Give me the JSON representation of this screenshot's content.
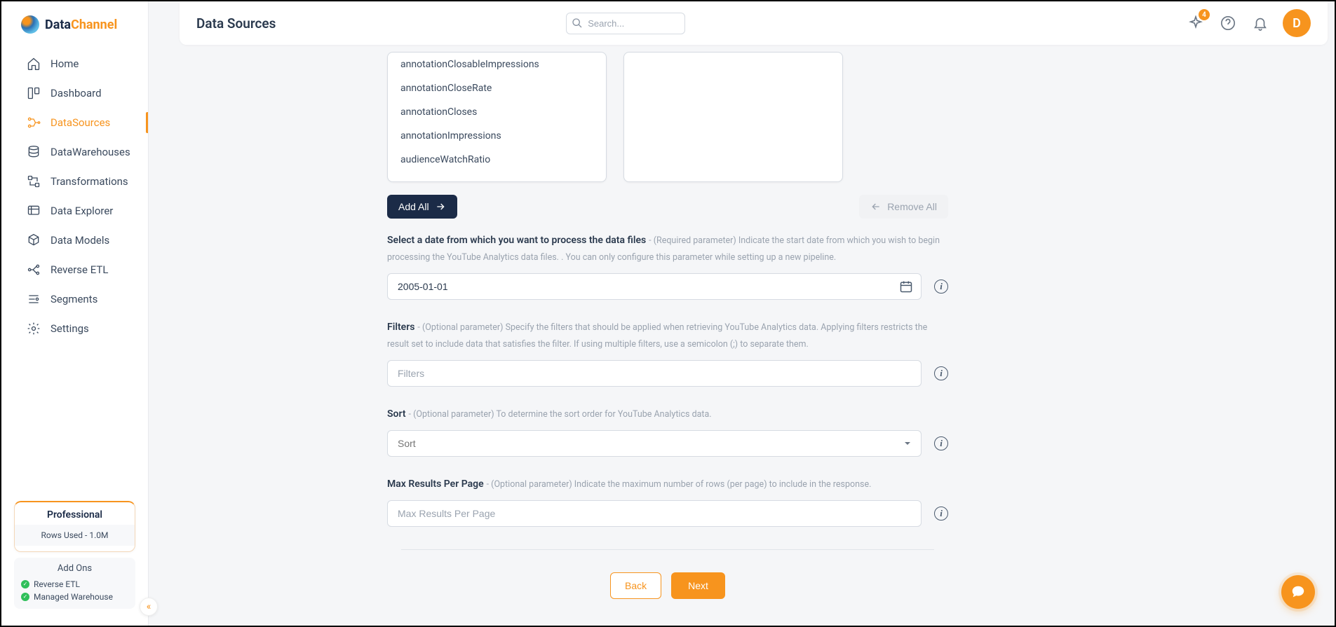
{
  "brand": {
    "part1": "Data",
    "part2": "Channel"
  },
  "nav": {
    "items": [
      {
        "label": "Home"
      },
      {
        "label": "Dashboard"
      },
      {
        "label": "DataSources"
      },
      {
        "label": "DataWarehouses"
      },
      {
        "label": "Transformations"
      },
      {
        "label": "Data Explorer"
      },
      {
        "label": "Data Models"
      },
      {
        "label": "Reverse ETL"
      },
      {
        "label": "Segments"
      },
      {
        "label": "Settings"
      }
    ]
  },
  "plan": {
    "title": "Professional",
    "rows_line": "Rows Used - 1.0M",
    "addons_title": "Add Ons",
    "addon1": "Reverse ETL",
    "addon2": "Managed Warehouse"
  },
  "topbar": {
    "title": "Data Sources",
    "search_placeholder": "Search...",
    "badge": "4",
    "avatar_initial": "D"
  },
  "metrics": {
    "items": [
      "annotationClosableImpressions",
      "annotationCloseRate",
      "annotationCloses",
      "annotationImpressions",
      "audienceWatchRatio"
    ]
  },
  "buttons": {
    "add_all": "Add All",
    "remove_all": "Remove All",
    "back": "Back",
    "next": "Next"
  },
  "fields": {
    "date": {
      "label": "Select a date from which you want to process the data files",
      "desc": " - (Required parameter) Indicate the start date from which you wish to begin processing the YouTube Analytics data files. . You can only configure this parameter while setting up a new pipeline.",
      "value": "2005-01-01"
    },
    "filters": {
      "label": "Filters",
      "desc": " - (Optional parameter) Specify the filters that should be applied when retrieving YouTube Analytics data. Applying filters restricts the result set to include data that satisfies the filter. If using multiple filters, use a semicolon (;) to separate them.",
      "placeholder": "Filters"
    },
    "sort": {
      "label": "Sort",
      "desc": " - (Optional parameter) To determine the sort order for YouTube Analytics data.",
      "placeholder": "Sort"
    },
    "max": {
      "label": "Max Results Per Page",
      "desc": " - (Optional parameter) Indicate the maximum number of rows (per page) to include in the response.",
      "placeholder": "Max Results Per Page"
    }
  }
}
